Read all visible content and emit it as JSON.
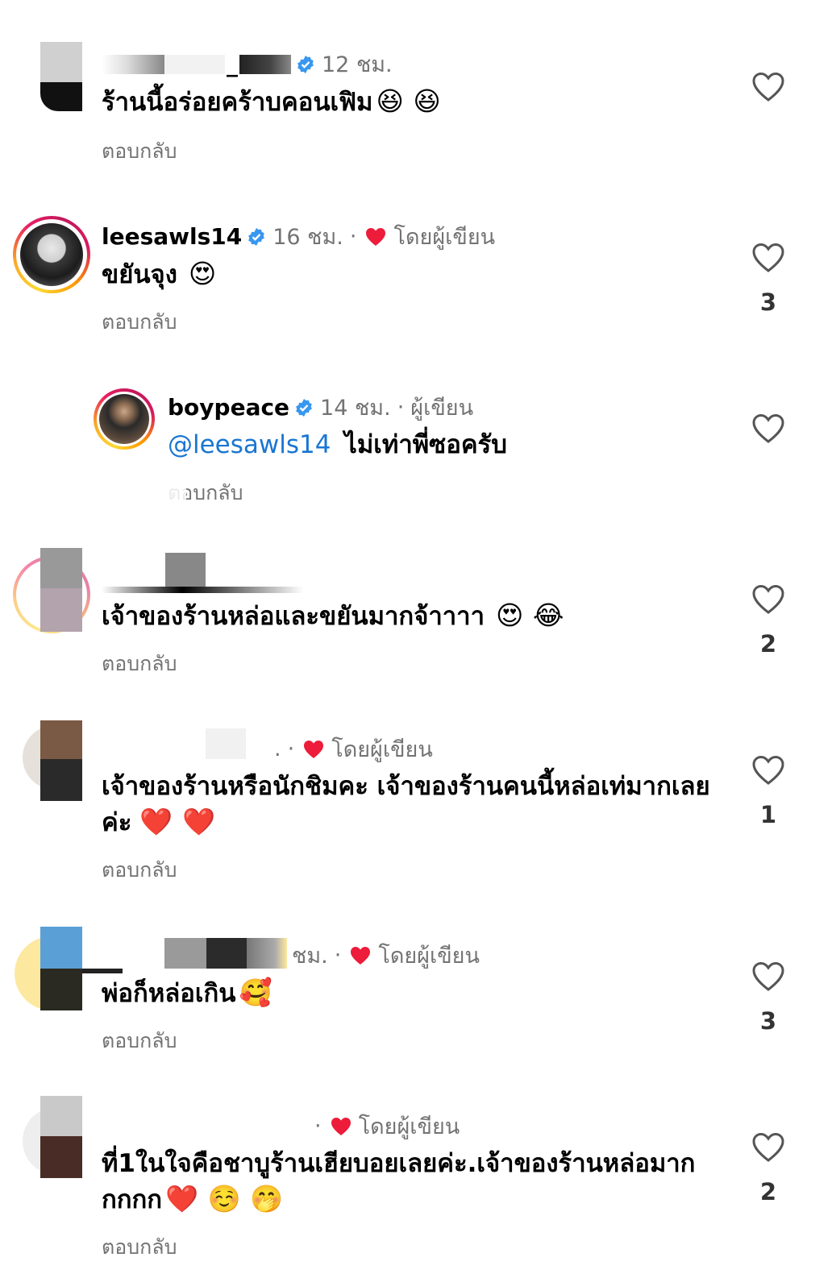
{
  "reply_label": "ตอบกลับ",
  "reply_label_partial": "ตอบกลับ",
  "author_badge": "โดยผู้เขียน",
  "author_tag": "ผู้เขียน",
  "colors": {
    "heart_red": "#ed1c3a",
    "verified_blue": "#3897f0",
    "mention_blue": "#1976d2",
    "meta_gray": "#737373"
  },
  "comments": [
    {
      "username": "_",
      "time": "12 ชม.",
      "text": "ร้านนี้อร่อยคร้าบคอนเฟิม",
      "emojis": "😆 😆",
      "likes": ""
    },
    {
      "username": "leesawls14",
      "time": "16 ชม.",
      "text": "ขยันจุง",
      "emojis": "😍",
      "likes": "3"
    },
    {
      "username": "boypeace",
      "time": "14 ชม.",
      "mention": "@leesawls14",
      "text": "ไม่เท่าพี่ซอครับ",
      "emojis": "",
      "likes": ""
    },
    {
      "username": "",
      "time": "",
      "text": "เจ้าของร้านหล่อและขยันมากจ้าาาา",
      "emojis": "😍 😂",
      "likes": "2"
    },
    {
      "username": "",
      "time": ".",
      "text_line1": "เจ้าของร้านหรือนักชิมคะ เจ้าของร้านคนนี้หล่อเท่มากเลย",
      "text_line2": "ค่ะ",
      "emojis": "❤️ ❤️",
      "likes": "1"
    },
    {
      "username": "",
      "time": "ชม.",
      "text": "พ่อก็หล่อเกิน",
      "emojis": "🥰",
      "likes": "3"
    },
    {
      "username": "",
      "time": "",
      "text_line1": "ที่1ในใจคือชาบูร้านเฮียบอยเลยค่ะ.เจ้าของร้านหล่อมาก",
      "text_line2": "กกกก",
      "emojis": "❤️ ☺️ 🤭",
      "likes": "2"
    }
  ]
}
